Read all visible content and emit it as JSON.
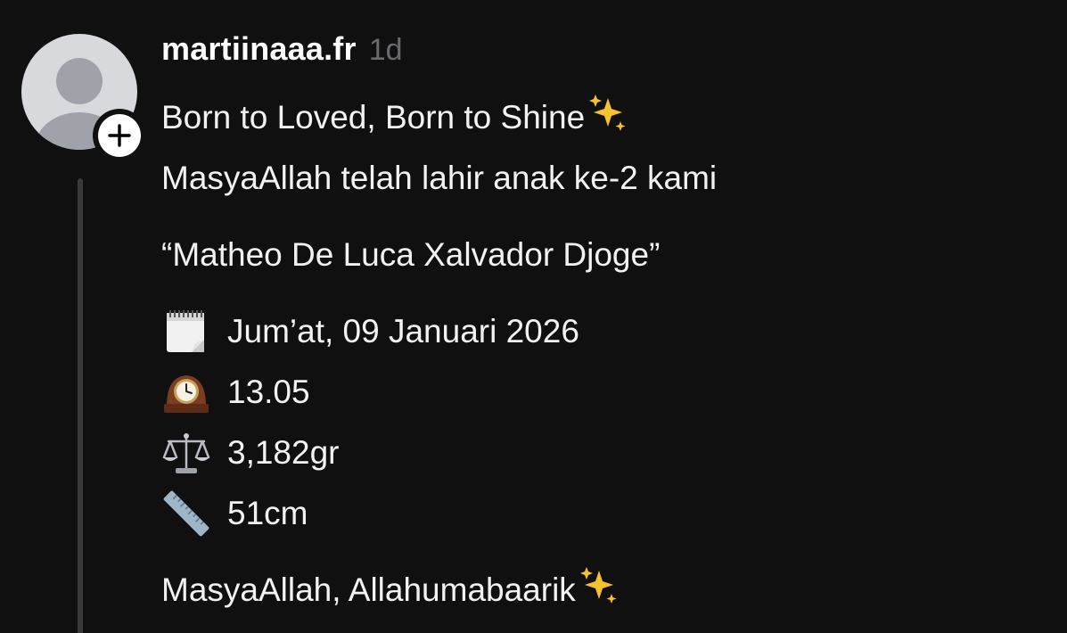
{
  "post": {
    "username": "martiinaaa.fr",
    "time": "1d",
    "line1": "Born to Loved, Born to Shine",
    "line2": "MasyaAllah telah lahir anak ke-2 kami",
    "name_line": "“Matheo De Luca Xalvador Djoge”",
    "details": [
      {
        "icon": "calendar-icon",
        "text": "Jum’at, 09 Januari 2026"
      },
      {
        "icon": "mantelpiece-clock-icon",
        "text": "13.05"
      },
      {
        "icon": "balance-scale-icon",
        "text": "3,182gr"
      },
      {
        "icon": "ruler-icon",
        "text": "51cm"
      }
    ],
    "closing": "MasyaAllah, Allahumabaarik"
  },
  "colors": {
    "background": "#101010",
    "text": "#f2f2f2",
    "muted": "#6b6b6f",
    "thread_line": "#3a3a3c",
    "sparkle": "#f5c22e"
  }
}
